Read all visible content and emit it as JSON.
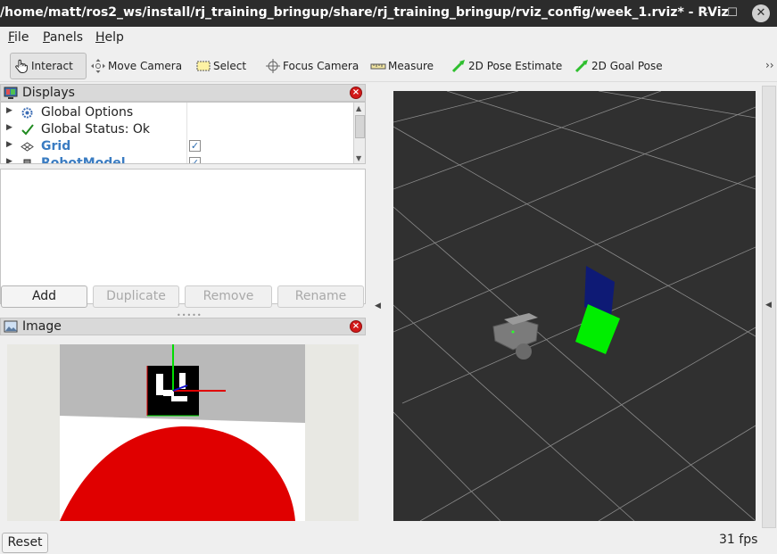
{
  "window": {
    "title": "/home/matt/ros2_ws/install/rj_training_bringup/share/rj_training_bringup/rviz_config/week_1.rviz* - RViz",
    "minimize": "–",
    "maximize": "☐",
    "close": "✕"
  },
  "menu": [
    {
      "first": "F",
      "rest": "ile"
    },
    {
      "first": "P",
      "rest": "anels"
    },
    {
      "first": "H",
      "rest": "elp"
    }
  ],
  "toolbar": {
    "tools": [
      {
        "label": "Interact",
        "icon": "hand-pointer-icon",
        "active": true
      },
      {
        "label": "Move Camera",
        "icon": "move-camera-icon"
      },
      {
        "label": "Select",
        "icon": "select-box-icon"
      },
      {
        "label": "Focus Camera",
        "icon": "focus-crosshair-icon"
      },
      {
        "label": "Measure",
        "icon": "ruler-icon"
      },
      {
        "label": "2D Pose Estimate",
        "icon": "green-arrow-icon"
      },
      {
        "label": "2D Goal Pose",
        "icon": "green-arrow-icon"
      }
    ],
    "more": "››"
  },
  "displays_panel": {
    "title": "Displays",
    "close": "×",
    "items": [
      {
        "label": "Global Options",
        "icon": "gear-icon",
        "checked": null,
        "highlight": false
      },
      {
        "label": "Global Status: Ok",
        "icon": "checkmark-icon",
        "checked": null,
        "highlight": false
      },
      {
        "label": "Grid",
        "icon": "grid-icon",
        "checked": "✓",
        "highlight": true
      },
      {
        "label": "RobotModel",
        "icon": "robot-icon",
        "checked": "✓",
        "highlight": true
      }
    ],
    "buttons": {
      "add": "Add",
      "duplicate": "Duplicate",
      "remove": "Remove",
      "rename": "Rename"
    }
  },
  "image_panel": {
    "title": "Image",
    "close": "×"
  },
  "status": {
    "reset": "Reset",
    "fps": "31 fps"
  },
  "colors": {
    "viewport_bg": "#303030",
    "grid_lines": "#8a8a8a",
    "marker_green": "#00ff00",
    "marker_blue": "#0e1a75",
    "red_object": "#e00000",
    "close_red": "#d21919"
  }
}
